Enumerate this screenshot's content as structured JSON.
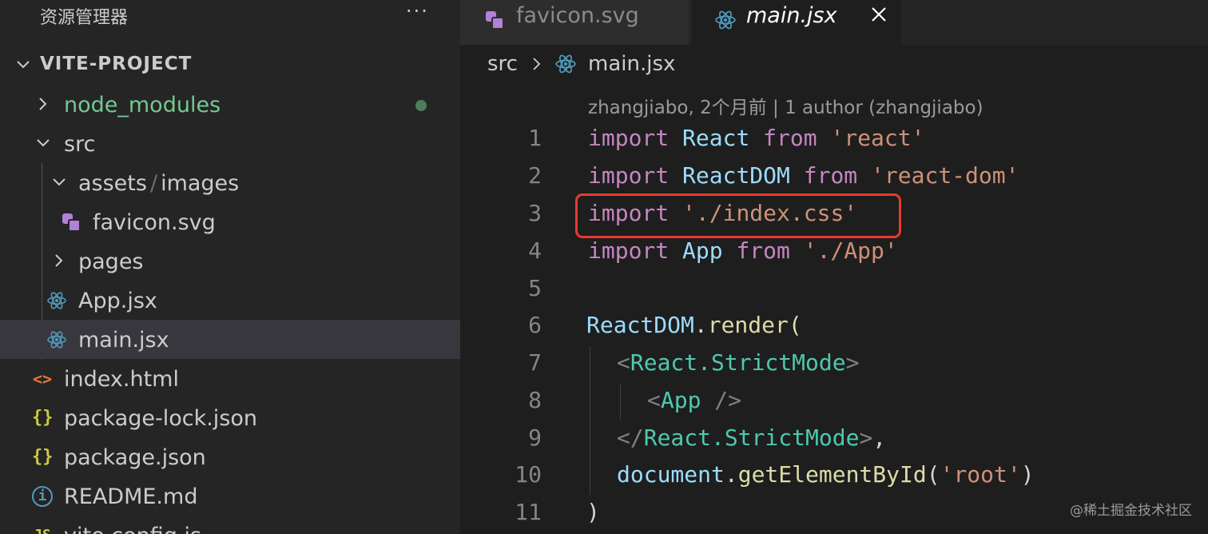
{
  "explorer": {
    "title": "资源管理器",
    "more_label": "···",
    "project_name": "VITE-PROJECT",
    "items": [
      {
        "label": "node_modules"
      },
      {
        "label": "src"
      },
      {
        "label_parts": [
          "assets",
          "/",
          "images"
        ]
      },
      {
        "label": "favicon.svg"
      },
      {
        "label": "pages"
      },
      {
        "label": "App.jsx"
      },
      {
        "label": "main.jsx"
      },
      {
        "label": "index.html",
        "icon_text": "<>"
      },
      {
        "label": "package-lock.json",
        "icon_text": "{}"
      },
      {
        "label": "package.json",
        "icon_text": "{}"
      },
      {
        "label": "README.md",
        "icon_text": "i"
      },
      {
        "label": "vite.config.js",
        "icon_text": "JS"
      }
    ]
  },
  "tabs": [
    {
      "label": "favicon.svg",
      "active": false
    },
    {
      "label": "main.jsx",
      "active": true
    }
  ],
  "breadcrumb": {
    "folder": "src",
    "file": "main.jsx"
  },
  "blame": "zhangjiabo, 2个月前 | 1 author (zhangjiabo)",
  "code": {
    "line_numbers": [
      "1",
      "2",
      "3",
      "4",
      "5",
      "6",
      "7",
      "8",
      "9",
      "10",
      "11"
    ],
    "l1": {
      "kw1": "import",
      "id": "React",
      "kw2": "from",
      "str": "'react'"
    },
    "l2": {
      "kw1": "import",
      "id": "ReactDOM",
      "kw2": "from",
      "str": "'react-dom'"
    },
    "l3": {
      "kw1": "import",
      "str": "'./index.css'"
    },
    "l4": {
      "kw1": "import",
      "id": "App",
      "kw2": "from",
      "str": "'./App'"
    },
    "l6": {
      "obj": "ReactDOM",
      "dot": ".",
      "fn": "render",
      "paren": "("
    },
    "l7": {
      "open": "<",
      "tag": "React.StrictMode",
      "close": ">"
    },
    "l8": {
      "open": "<",
      "tag": "App",
      "close": " />"
    },
    "l9": {
      "open": "</",
      "tag": "React.StrictMode",
      "close": ">",
      "comma": ","
    },
    "l10": {
      "obj": "document",
      "dot": ".",
      "fn": "getElementById",
      "p1": "(",
      "str": "'root'",
      "p2": ")"
    },
    "l11": {
      "paren": ")"
    }
  },
  "watermark": "@稀土掘金技术社区",
  "colors": {
    "highlight_border": "#e63b2e",
    "keyword": "#c586c0",
    "string": "#ce9178",
    "tag": "#4ec9b0",
    "git_untracked": "#73c991"
  }
}
